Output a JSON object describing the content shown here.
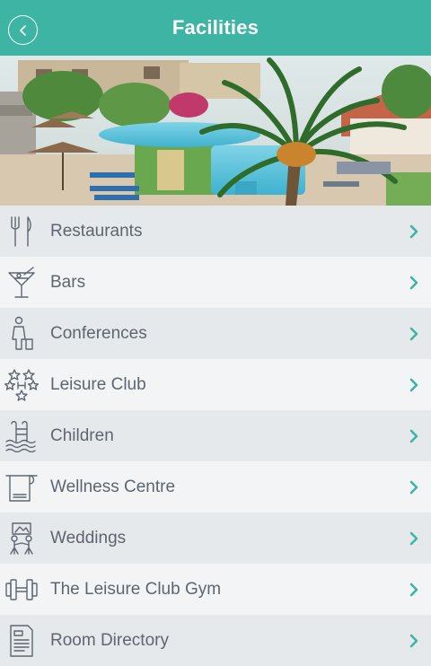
{
  "header": {
    "title": "Facilities",
    "back_icon": "chevron-left-icon",
    "background": "#3eb4a4"
  },
  "hero": {
    "icon": "hotel-pool-photo"
  },
  "menu": {
    "chevron_color": "#3eb4a4",
    "items": [
      {
        "label": "Restaurants",
        "icon": "fork-knife-icon"
      },
      {
        "label": "Bars",
        "icon": "cocktail-glass-icon"
      },
      {
        "label": "Conferences",
        "icon": "speaker-podium-icon"
      },
      {
        "label": "Leisure Club",
        "icon": "stars-icon"
      },
      {
        "label": "Children",
        "icon": "pool-ladder-icon"
      },
      {
        "label": "Wellness Centre",
        "icon": "towel-icon"
      },
      {
        "label": "Weddings",
        "icon": "couple-icon"
      },
      {
        "label": "The Leisure Club Gym",
        "icon": "dumbbell-icon"
      },
      {
        "label": "Room Directory",
        "icon": "pdf-document-icon"
      }
    ]
  }
}
